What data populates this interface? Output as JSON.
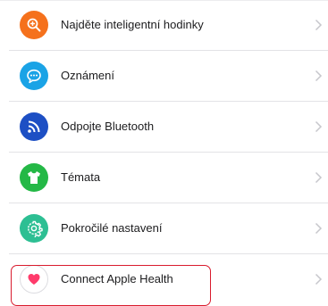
{
  "settings": {
    "items": [
      {
        "label": "Najděte inteligentní hodinky",
        "icon": "magnifier-plus-icon",
        "color": "#f5711c"
      },
      {
        "label": "Oznámení",
        "icon": "chat-bubble-icon",
        "color": "#1aa3e6"
      },
      {
        "label": "Odpojte Bluetooth",
        "icon": "signal-waves-icon",
        "color": "#1d4fc4"
      },
      {
        "label": "Témata",
        "icon": "tshirt-icon",
        "color": "#24b846"
      },
      {
        "label": "Pokročilé nastavení",
        "icon": "gear-icon",
        "color": "#2dbf93"
      },
      {
        "label": "Connect Apple Health",
        "icon": "heart-icon",
        "color": "#ff3b6b"
      }
    ],
    "highlight_color": "#d91c2e"
  }
}
